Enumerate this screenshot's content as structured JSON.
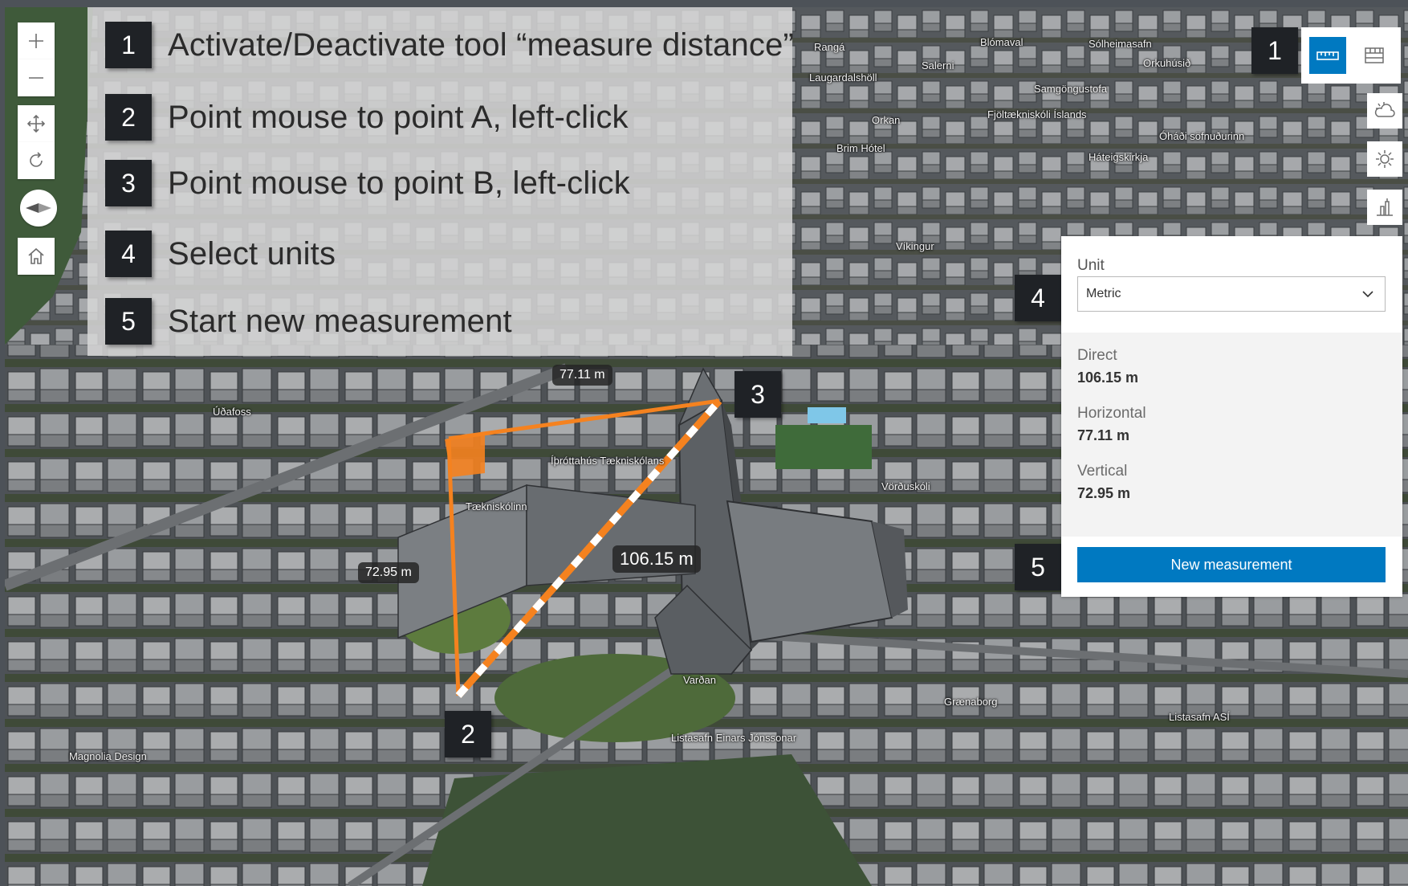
{
  "instructions": [
    {
      "num": "1",
      "text": "Activate/Deactivate tool “measure distance”"
    },
    {
      "num": "2",
      "text": "Point mouse to point A, left-click"
    },
    {
      "num": "3",
      "text": "Point mouse to point B, left-click"
    },
    {
      "num": "4",
      "text": "Select units"
    },
    {
      "num": "5",
      "text": "Start new measurement"
    }
  ],
  "callouts": {
    "toolbar": "1",
    "point_a": "2",
    "point_b": "3",
    "unit": "4",
    "new": "5"
  },
  "panel": {
    "unit_label": "Unit",
    "unit_value": "Metric",
    "direct_label": "Direct",
    "direct_value": "106.15 m",
    "horizontal_label": "Horizontal",
    "horizontal_value": "77.11 m",
    "vertical_label": "Vertical",
    "vertical_value": "72.95 m",
    "new_button": "New measurement"
  },
  "scene_labels": {
    "direct": "106.15 m",
    "horizontal": "77.11 m",
    "vertical": "72.95 m"
  },
  "places": [
    "Rangá",
    "Salerni",
    "Blómaval",
    "Sólheimasafn",
    "Orkuhúsið",
    "Laugardalshöll",
    "Samgöngustofa",
    "Orkan",
    "Fjöltækniskóli Íslands",
    "Óháði söfnuðurinn",
    "Brim Hótel",
    "Háteigskirkja",
    "Víkingur",
    "Úðafoss",
    "Íþróttahús Tækniskólans",
    "Tækniskólinn",
    "Vörðuskóli",
    "Varðan",
    "Grænaborg",
    "Listasafn ASÍ",
    "Listasafn Einars Jónssonar",
    "Magnolia Design"
  ],
  "colors": {
    "accent": "#0079c1",
    "measure_line": "#f5821f",
    "badge": "#1f2226"
  },
  "icons": {
    "zoom_in": "plus-icon",
    "zoom_out": "minus-icon",
    "pan": "pan-icon",
    "rotate": "rotate-icon",
    "compass": "compass-icon",
    "home": "home-icon",
    "line_measure": "line-measure-icon",
    "area_measure": "area-measure-icon",
    "daylight": "daylight-icon",
    "weather": "weather-icon",
    "elevation": "elevation-icon",
    "chevron": "chevron-down-icon"
  }
}
